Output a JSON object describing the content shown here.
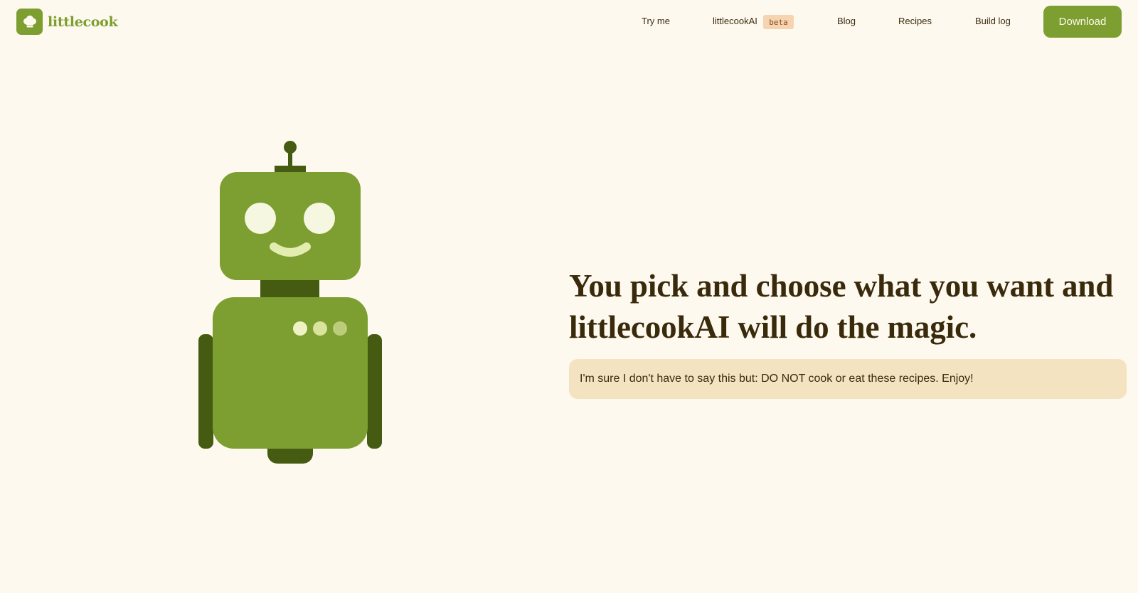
{
  "brand": {
    "name": "littlecook",
    "logo_icon": "chef-hat-icon",
    "color": "#7d9e31"
  },
  "nav": {
    "items": [
      {
        "label": "Try me"
      },
      {
        "label": "littlecookAI",
        "badge": "beta"
      },
      {
        "label": "Blog"
      },
      {
        "label": "Recipes"
      },
      {
        "label": "Build log"
      }
    ],
    "download_label": "Download"
  },
  "hero": {
    "headline_line1": "You pick and choose what you want and",
    "headline_line2": "littlecookAI will do the magic.",
    "notice": "I'm sure I don't have to say this but: DO NOT cook or eat these recipes. Enjoy!",
    "illustration": "robot-illustration"
  },
  "colors": {
    "background": "#fef9ee",
    "accent": "#7d9e31",
    "accent_dark": "#455b12",
    "notice_bg": "#f3e3c0",
    "badge_bg": "#f6d4b2",
    "text": "#3a2a0c"
  }
}
